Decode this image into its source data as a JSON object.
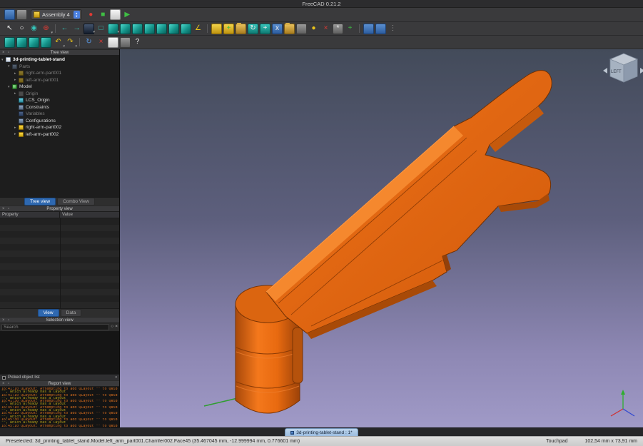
{
  "window": {
    "title": "FreeCAD 0.21.2"
  },
  "toolbars": {
    "workbench": {
      "label": "Assembly 4"
    },
    "row1a": [
      {
        "name": "windows-icon",
        "cls": "k-blue"
      },
      {
        "name": "new-window-icon",
        "cls": "k-gray"
      }
    ],
    "row1b": [
      {
        "name": "macro-record-icon",
        "cls": "k-plain c-red",
        "glyph": "●"
      },
      {
        "name": "macro-stop-icon",
        "cls": "k-plain c-green",
        "glyph": "■"
      },
      {
        "name": "macro-edit-icon",
        "cls": "k-white"
      },
      {
        "name": "macro-play-icon",
        "cls": "k-plain c-green",
        "glyph": "▶"
      }
    ],
    "row2": [
      {
        "name": "pointer-select-icon",
        "cls": "k-plain c-white",
        "glyph": "↖"
      },
      {
        "name": "zoom-icon",
        "cls": "k-plain c-white",
        "glyph": "○"
      },
      {
        "name": "box-selection-icon",
        "cls": "k-plain c-teal",
        "glyph": "◉"
      },
      {
        "name": "fit-all-icon",
        "cls": "k-plain c-red",
        "glyph": "⊕",
        "caret": "▾"
      },
      {
        "name": "separator",
        "cls": "k-sep"
      },
      {
        "name": "nav-back-icon",
        "cls": "k-plain c-teal",
        "glyph": "←"
      },
      {
        "name": "nav-forward-icon",
        "cls": "k-plain c-teal",
        "glyph": "→"
      },
      {
        "name": "draw-style-icon",
        "cls": "k-screen",
        "caret": "▾"
      },
      {
        "name": "zoom-region-icon",
        "cls": "k-plain c-teal",
        "glyph": "□"
      },
      {
        "name": "view-axonometric-icon",
        "cls": "k-cyan-cube",
        "caret": "▾"
      },
      {
        "name": "view-front-icon",
        "cls": "k-cyan-cube"
      },
      {
        "name": "view-top-icon",
        "cls": "k-cyan-cube"
      },
      {
        "name": "view-right-icon",
        "cls": "k-cyan-cube"
      },
      {
        "name": "view-rear-icon",
        "cls": "k-cyan-cube"
      },
      {
        "name": "view-bottom-icon",
        "cls": "k-cyan-cube"
      },
      {
        "name": "view-left-icon",
        "cls": "k-cyan-cube"
      },
      {
        "name": "measure-icon",
        "cls": "k-plain c-yellow",
        "glyph": "∠"
      },
      {
        "name": "separator",
        "cls": "k-sep"
      },
      {
        "name": "new-assembly-icon",
        "cls": "k-yellow"
      },
      {
        "name": "insert-part-icon",
        "cls": "k-yellow c-green",
        "glyph": "+"
      },
      {
        "name": "open-document-icon",
        "cls": "k-folder"
      },
      {
        "name": "solve-assembly-icon",
        "cls": "k-cyan c-white",
        "glyph": "↻"
      },
      {
        "name": "new-lcs-icon",
        "cls": "k-cyan c-white",
        "glyph": "+"
      },
      {
        "name": "variables-icon",
        "cls": "k-blue c-white",
        "glyph": "x"
      },
      {
        "name": "folder-icon",
        "cls": "k-folder"
      },
      {
        "name": "configuration-icon",
        "cls": "k-gray"
      },
      {
        "name": "bulb-icon",
        "cls": "k-plain c-yellow",
        "glyph": "●"
      },
      {
        "name": "delete-icon",
        "cls": "k-plain c-red",
        "glyph": "×"
      },
      {
        "name": "gear-icon",
        "cls": "k-gray c-white",
        "glyph": "*"
      },
      {
        "name": "add-variable-icon",
        "cls": "k-plain c-green",
        "glyph": "+"
      },
      {
        "name": "separator",
        "cls": "k-sep"
      },
      {
        "name": "align-horizontal-icon",
        "cls": "k-blue"
      },
      {
        "name": "align-vertical-icon",
        "cls": "k-blue"
      },
      {
        "name": "overflow-menu-icon",
        "cls": "k-plain c-gray",
        "glyph": "⋮"
      }
    ],
    "row3": [
      {
        "name": "view-isometric-icon",
        "cls": "k-cyan-cube"
      },
      {
        "name": "view-dimetric-icon",
        "cls": "k-cyan-cube"
      },
      {
        "name": "view-trimetric-icon",
        "cls": "k-cyan-cube"
      },
      {
        "name": "view-home-icon",
        "cls": "k-cyan-cube"
      },
      {
        "name": "undo-icon",
        "cls": "k-plain c-yellow",
        "glyph": "↶",
        "caret": "▾"
      },
      {
        "name": "redo-icon",
        "cls": "k-plain c-yellow",
        "glyph": "↷",
        "caret": "▾"
      },
      {
        "name": "separator",
        "cls": "k-sep"
      },
      {
        "name": "refresh-icon",
        "cls": "k-plain c-blue",
        "glyph": "↻"
      },
      {
        "name": "cut-icon",
        "cls": "k-plain c-red",
        "glyph": "×"
      },
      {
        "name": "copy-icon",
        "cls": "k-white"
      },
      {
        "name": "paste-icon",
        "cls": "k-gray"
      },
      {
        "name": "whats-this-icon",
        "cls": "k-plain c-white",
        "glyph": "?"
      }
    ]
  },
  "panels": {
    "tree": {
      "title": "Tree view",
      "items": [
        {
          "label": "3d-printing-tablet-stand",
          "icon": "ti-doc",
          "cls": "d0 root",
          "arrow": "▾"
        },
        {
          "label": "Parts",
          "icon": "ti-folder",
          "cls": "d1 dim",
          "arrow": "▾"
        },
        {
          "label": "right-arm-part001",
          "icon": "ti-part",
          "cls": "d2 dim",
          "arrow": "▸"
        },
        {
          "label": "left-arm-part001",
          "icon": "ti-part",
          "cls": "d2 dim",
          "arrow": "▸"
        },
        {
          "label": "Model",
          "icon": "ti-model",
          "cls": "d1",
          "arrow": "▾"
        },
        {
          "label": "Origin",
          "icon": "ti-origin",
          "cls": "d2 dim",
          "arrow": "▸"
        },
        {
          "label": "LCS_Origin",
          "icon": "ti-lcs",
          "cls": "d2"
        },
        {
          "label": "Constraints",
          "icon": "ti-folder",
          "cls": "d2"
        },
        {
          "label": "Variables",
          "icon": "ti-var",
          "cls": "d2 dim"
        },
        {
          "label": "Configurations",
          "icon": "ti-folder",
          "cls": "d2"
        },
        {
          "label": "right-arm-part002",
          "icon": "ti-part",
          "cls": "d2",
          "arrow": "▸"
        },
        {
          "label": "left-arm-part002",
          "icon": "ti-part",
          "cls": "d2",
          "arrow": "▸"
        }
      ],
      "tabs": [
        {
          "label": "Tree view",
          "active": true
        },
        {
          "label": "Combo View",
          "active": false
        }
      ]
    },
    "property": {
      "title": "Property view",
      "columns": [
        "Property",
        "Value"
      ],
      "tabs": [
        {
          "label": "View",
          "active": true
        },
        {
          "label": "Data",
          "active": false
        }
      ]
    },
    "selection": {
      "title": "Selection view",
      "search_placeholder": "Search",
      "picked_label": "Picked object list"
    },
    "report": {
      "title": "Report view",
      "lines": [
        "16:41:10  QLayout: Attempting to add QLayout \"\" to QWidget",
        "\"\", which already has a layout",
        "16:41:10  QLayout: Attempting to add QLayout \"\" to QWidget",
        "\"\", which already has a layout",
        "16:41:30  QLayout: Attempting to add QLayout \"\" to QWidget",
        "\"\", which already has a layout",
        "16:45:10  QLayout: Attempting to add QLayout \"\" to QWidget",
        "\"\", which already has a layout",
        "16:45:10  QLayout: Attempting to add QLayout \"\" to QWidget",
        "\"\", which already has a layout",
        "16:45:30  QLayout: Attempting to add QLayout \"\" to QWidget",
        "\"\", which already has a layout",
        "16:45:10  QLayout: Attempting to add QLayout \"\" to QWidget",
        "\"\", which already has a layout"
      ]
    }
  },
  "viewport": {
    "nav_cube_label": "LEFT",
    "document_tab": "3d-printing-tablet-stand : 1*",
    "colors": {
      "model_orange": "#e2620e",
      "model_dark": "#a84a08",
      "model_light": "#f5882e",
      "background_top": "#434b5a",
      "background_bottom": "#a09ac7"
    }
  },
  "statusbar": {
    "preselect": "Preselected: 3d_printing_tablet_stand.Model.left_arm_part001.Chamfer002.Face45 (35.467045 mm, -12.999994 mm, 0.776601 mm)",
    "nav_style": "Touchpad",
    "dimensions": "102,54 mm x 73,91 mm"
  }
}
